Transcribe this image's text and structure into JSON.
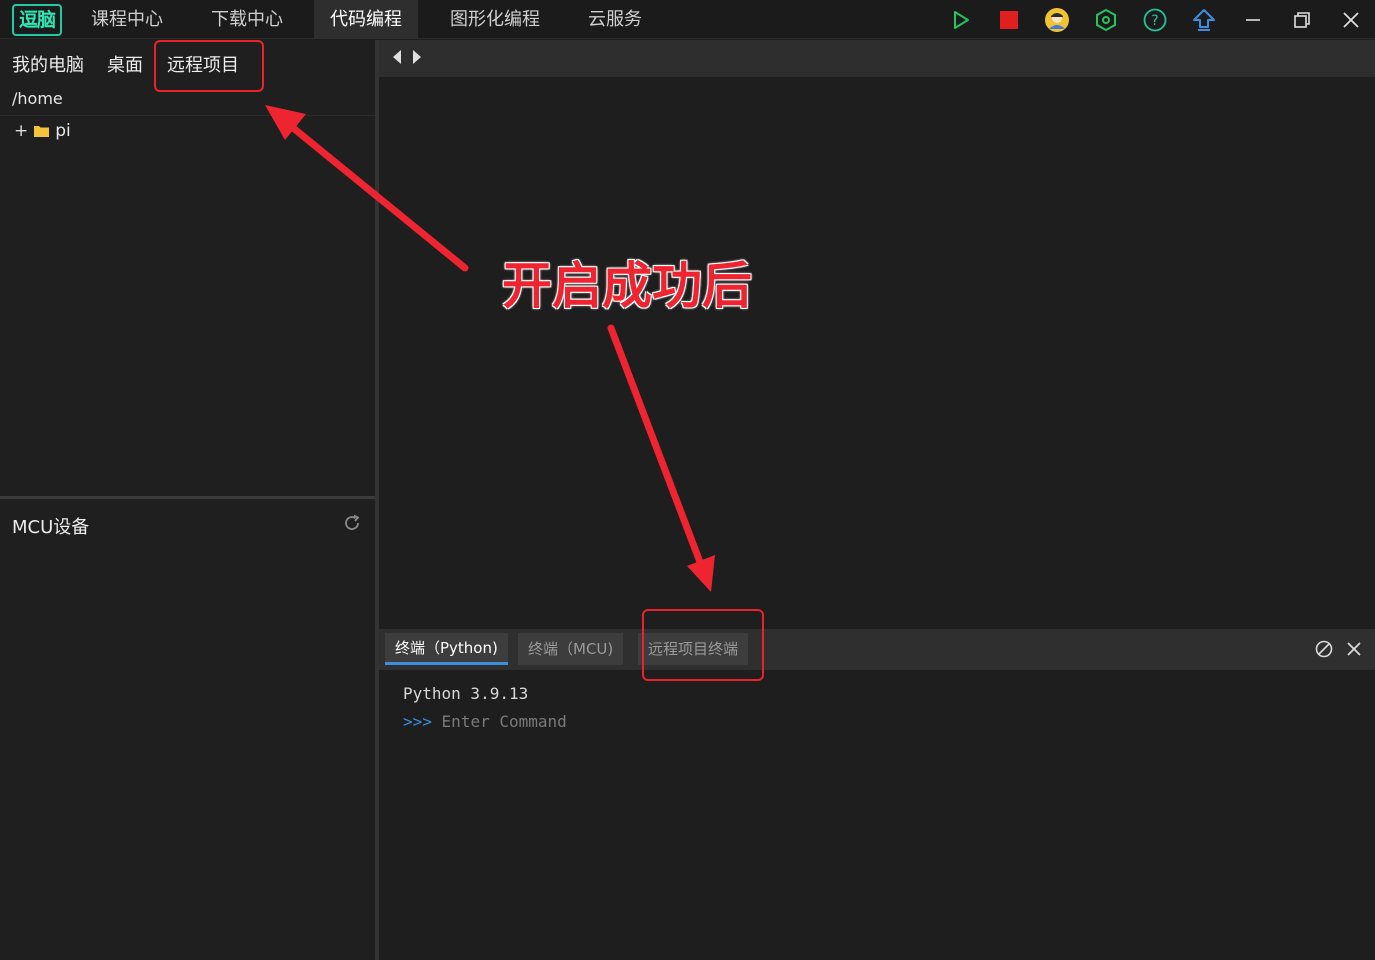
{
  "app": {
    "logo_text": "逗脑",
    "nav_tabs": [
      {
        "label": "课程中心"
      },
      {
        "label": "下载中心"
      },
      {
        "label": "代码编程"
      },
      {
        "label": "图形化编程"
      },
      {
        "label": "云服务"
      }
    ],
    "active_tab": "代码编程",
    "toolbar_icons": [
      "run-icon",
      "stop-icon",
      "user-avatar-icon",
      "settings-hex-icon",
      "help-icon",
      "upload-icon",
      "minimize-icon",
      "restore-icon",
      "close-icon"
    ],
    "colors": {
      "run": "#22c55e",
      "stop": "#e02020",
      "accent": "#3d8de0",
      "annotation": "#ee2430",
      "logo": "#22c8a0"
    }
  },
  "left_panel": {
    "tabs": [
      {
        "label": "我的电脑"
      },
      {
        "label": "桌面"
      },
      {
        "label": "远程项目"
      }
    ],
    "path": "/home",
    "tree": [
      {
        "expander": "+",
        "name": "pi",
        "icon": "folder-icon"
      }
    ],
    "mcu_title": "MCU设备"
  },
  "terminal": {
    "tabs": [
      {
        "label": "终端（Python)"
      },
      {
        "label": "终端（MCU)"
      },
      {
        "label": "远程项目终端"
      }
    ],
    "active_tab": "终端（Python)",
    "version_line": "Python 3.9.13",
    "prompt_symbol": ">>>",
    "placeholder": "Enter Command"
  },
  "annotation": {
    "text": "开启成功后"
  }
}
